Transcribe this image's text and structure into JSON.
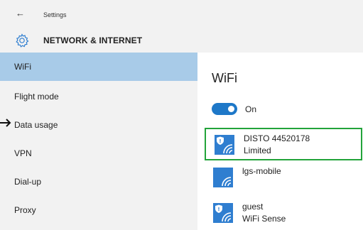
{
  "window": {
    "title": "Settings",
    "back_icon": "back-arrow-icon"
  },
  "header": {
    "title": "NETWORK & INTERNET",
    "icon": "gear-icon"
  },
  "sidebar": {
    "items": [
      {
        "label": "WiFi",
        "selected": true
      },
      {
        "label": "Flight mode",
        "selected": false
      },
      {
        "label": "Data usage",
        "selected": false
      },
      {
        "label": "VPN",
        "selected": false
      },
      {
        "label": "Dial-up",
        "selected": false
      },
      {
        "label": "Proxy",
        "selected": false
      }
    ]
  },
  "main": {
    "title": "WiFi",
    "toggle": {
      "label": "On",
      "state": true
    },
    "networks": [
      {
        "name": "DISTO 44520178",
        "status": "Limited",
        "secured": true,
        "highlighted": true
      },
      {
        "name": "lgs-mobile",
        "status": "",
        "secured": false,
        "highlighted": false
      },
      {
        "name": "guest",
        "status": "WiFi Sense",
        "secured": true,
        "highlighted": false
      }
    ]
  },
  "colors": {
    "accent": "#1e78c8",
    "selected_item": "#a8cbe8",
    "tile": "#2f7ed0",
    "highlight_border": "#22a33a",
    "panel": "#f2f2f2"
  }
}
